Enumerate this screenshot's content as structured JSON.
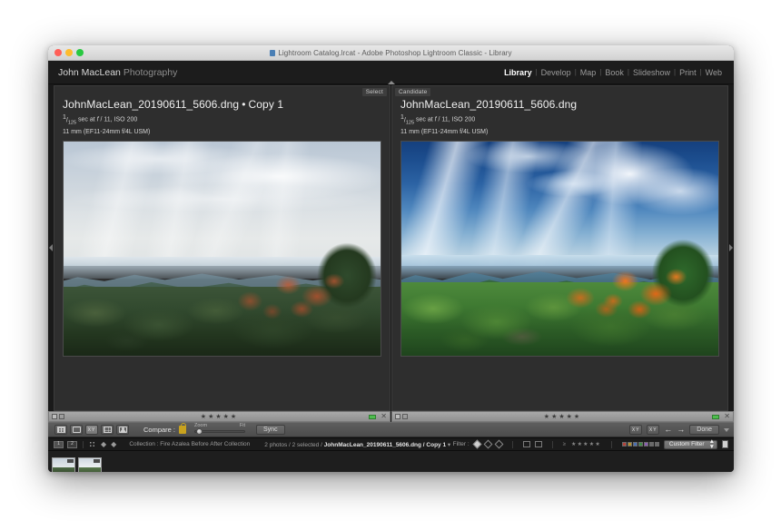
{
  "titlebar": {
    "document_title": "Lightroom Catalog.lrcat - Adobe Photoshop Lightroom Classic - Library",
    "doc_icon": "document-icon",
    "traffic_lights": [
      "close",
      "minimize",
      "zoom"
    ]
  },
  "identity": {
    "name": "John MacLean",
    "suffix": "Photography"
  },
  "modules": [
    {
      "label": "Library",
      "active": true
    },
    {
      "label": "Develop",
      "active": false
    },
    {
      "label": "Map",
      "active": false
    },
    {
      "label": "Book",
      "active": false
    },
    {
      "label": "Slideshow",
      "active": false
    },
    {
      "label": "Print",
      "active": false
    },
    {
      "label": "Web",
      "active": false
    }
  ],
  "module_separator": "|",
  "compare": {
    "select": {
      "tag": "Select",
      "filename": "JohnMacLean_20190611_5606.dng",
      "copy_separator": "•",
      "copy": "Copy 1",
      "shutter_numerator": "1",
      "shutter_denominator": "125",
      "exposure_rest": " sec at ",
      "aperture_symbol": "f",
      "aperture_value": " / 11, ISO 200",
      "lens_line": "11 mm (EF11-24mm f/4L USM)"
    },
    "candidate": {
      "tag": "Candidate",
      "filename": "JohnMacLean_20190611_5606.dng",
      "shutter_numerator": "1",
      "shutter_denominator": "125",
      "exposure_rest": " sec at ",
      "aperture_symbol": "f",
      "aperture_value": " / 11, ISO 200",
      "lens_line": "11 mm (EF11-24mm f/4L USM)"
    }
  },
  "infobar": {
    "stars": "★★★★★",
    "flag_icon": "flag-icon",
    "flag_outline_icon": "flag-outline-icon",
    "color_chip": "#4fbd4f",
    "reject_mark": "✕"
  },
  "toolbar": {
    "view_modes": [
      {
        "name": "grid-view-icon",
        "label": "Grid"
      },
      {
        "name": "loupe-view-icon",
        "label": "Loupe"
      },
      {
        "name": "compare-view-icon",
        "label": "XY"
      },
      {
        "name": "survey-view-icon",
        "label": "Survey"
      },
      {
        "name": "people-view-icon",
        "label": "People"
      }
    ],
    "compare_label": "Compare :",
    "lock_icon": "lock-icon",
    "zoom_label": "Zoom",
    "fit_label": "Fit",
    "sync_label": "Sync",
    "swap_label": "XY",
    "make_select_label": "XY",
    "prev_arrow": "←",
    "next_arrow": "→",
    "done_label": "Done"
  },
  "statusbar": {
    "page_first": "1",
    "page_second": "2",
    "collection_label": "Collection : Fire Azalea Before After Collection",
    "selection_prefix": "2 photos / 2 selected / ",
    "selection_file": "JohnMacLean_20190611_5606.dng / Copy 1",
    "selection_caret": "▾",
    "filter_label": "Filter :",
    "filter_stars": "★★★★★",
    "filter_ge": "≥",
    "custom_filter_label": "Custom Filter",
    "color_swatches": [
      "#b4433a",
      "#b8902c",
      "#4a6fb0",
      "#3f8a46",
      "#8a5fb0",
      "#6a6a6a",
      "#6a6a6a"
    ]
  },
  "filmstrip": {
    "thumbnails": [
      {
        "name": "filmstrip-thumb-before",
        "variant": "before"
      },
      {
        "name": "filmstrip-thumb-after",
        "variant": "after"
      }
    ]
  },
  "colors": {
    "window_bg": "#2a2a2a",
    "topbar_bg": "#1c1c1c",
    "content_bg": "#252525",
    "accent_green": "#4fbd4f",
    "lock_gold": "#c8a21e"
  }
}
